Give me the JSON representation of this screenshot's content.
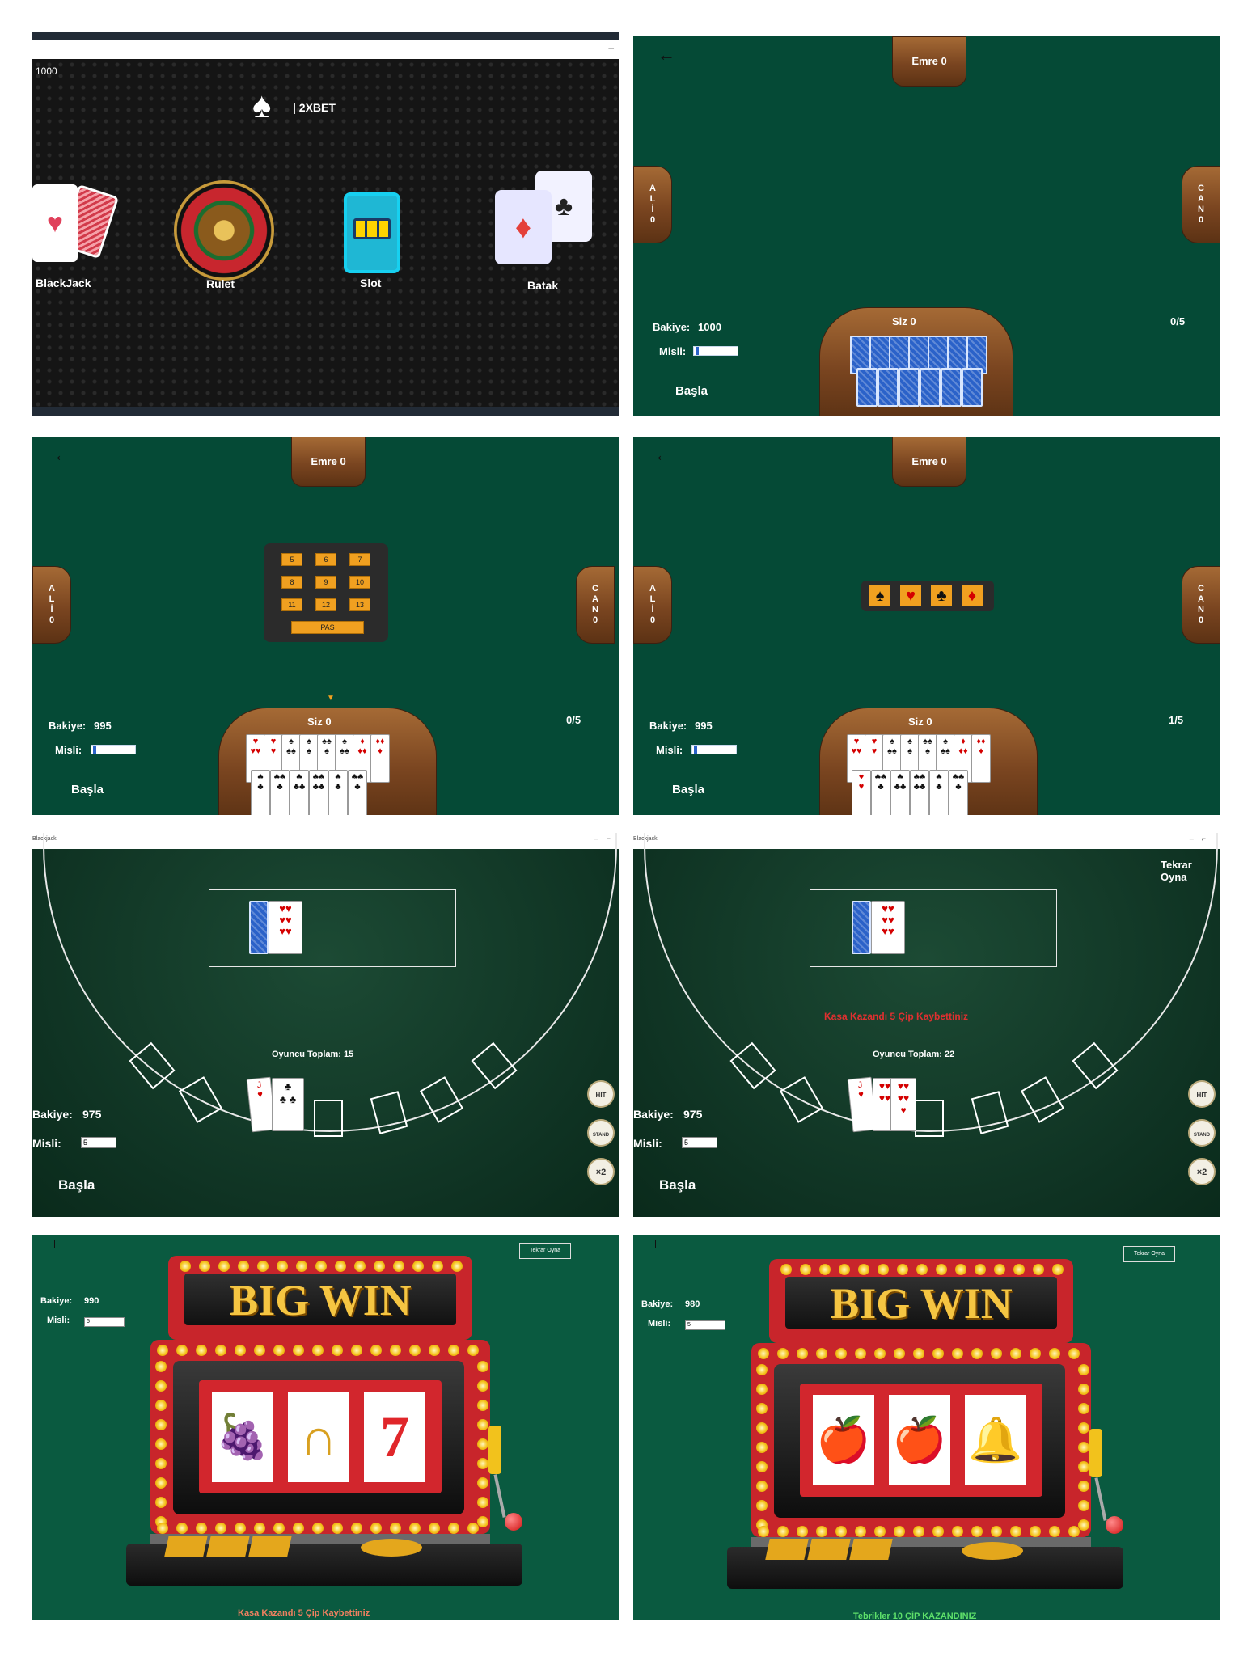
{
  "menu": {
    "balance": "1000",
    "brand": "| 2XBET",
    "minimize": "–",
    "games": [
      "BlackJack",
      "Rulet",
      "Slot",
      "Batak"
    ],
    "colors": {
      "bg": "#151515",
      "accent": "#ffffff"
    }
  },
  "batak1": {
    "top_player": "Emre  0",
    "left_player": [
      "A",
      "L",
      "İ",
      "0"
    ],
    "right_player": [
      "C",
      "A",
      "N",
      "0"
    ],
    "me": "Siz    0",
    "balance_label": "Bakiye:",
    "balance_value": "1000",
    "misli_label": "Misli:",
    "start": "Başla",
    "round": "0/5"
  },
  "batak2": {
    "top_player": "Emre  0",
    "left_player": [
      "A",
      "L",
      "İ",
      "0"
    ],
    "right_player": [
      "C",
      "A",
      "N",
      "0"
    ],
    "bids": [
      "5",
      "6",
      "7",
      "8",
      "9",
      "10",
      "11",
      "12",
      "13"
    ],
    "pass": "PAS",
    "me": "Siz    0",
    "balance_label": "Bakiye:",
    "balance_value": "995",
    "misli_label": "Misli:",
    "start": "Başla",
    "round": "0/5"
  },
  "batak3": {
    "top_player": "Emre  0",
    "left_player": [
      "A",
      "L",
      "İ",
      "0"
    ],
    "right_player": [
      "C",
      "A",
      "N",
      "0"
    ],
    "suits": [
      "♠",
      "♥",
      "♣",
      "♦"
    ],
    "me": "Siz    0",
    "balance_label": "Bakiye:",
    "balance_value": "995",
    "misli_label": "Misli:",
    "start": "Başla",
    "round": "1/5"
  },
  "bj1": {
    "title": "Blackjack",
    "player_total": "Oyuncu Toplam:   15",
    "balance_label": "Bakiye:",
    "balance_value": "975",
    "misli_label": "Misli:",
    "misli_value": "5",
    "start": "Başla",
    "buttons": [
      "HIT",
      "STAND",
      "×2"
    ]
  },
  "bj2": {
    "title": "Blackjack",
    "replay": "Tekrar Oyna",
    "result": "Kasa Kazandı 5 Çip Kaybettiniz",
    "player_total": "Oyuncu Toplam:   22",
    "balance_label": "Bakiye:",
    "balance_value": "975",
    "misli_label": "Misli:",
    "misli_value": "5",
    "start": "Başla",
    "buttons": [
      "HIT",
      "STAND",
      "×2"
    ]
  },
  "slot1": {
    "replay": "Tekrar Oyna",
    "balance_label": "Bakiye:",
    "balance_value": "990",
    "misli_label": "Misli:",
    "misli_value": "5",
    "banner": "BIG WIN",
    "reels": [
      "🍇",
      "∩",
      "7"
    ],
    "result": "Kasa Kazandı 5 Çip Kaybettiniz"
  },
  "slot2": {
    "replay": "Tekrar Oyna",
    "balance_label": "Bakiye:",
    "balance_value": "980",
    "misli_label": "Misli:",
    "misli_value": "5",
    "banner": "BIG WIN",
    "reels": [
      "🍎",
      "🍎",
      "🔔"
    ],
    "result": "Tebrikler 10 ÇİP KAZANDINIZ"
  }
}
